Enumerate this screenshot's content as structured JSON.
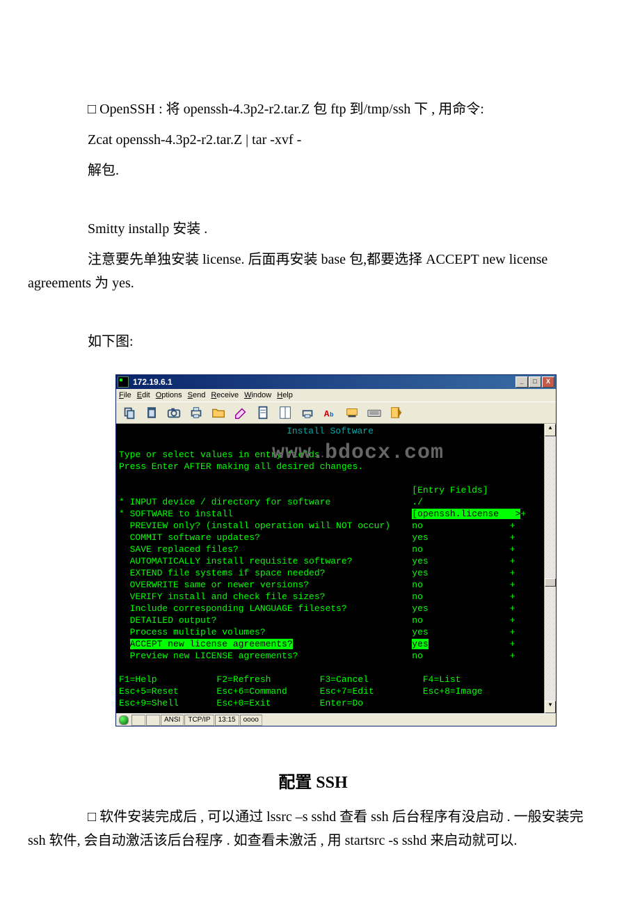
{
  "doc": {
    "p1": "□ OpenSSH : 将 openssh-4.3p2-r2.tar.Z 包 ftp 到/tmp/ssh 下 , 用命令:",
    "p2": "Zcat openssh-4.3p2-r2.tar.Z | tar -xvf -",
    "p3": "解包.",
    "p4": "Smitty installp 安装 .",
    "p5": "注意要先单独安装 license. 后面再安装 base 包,都要选择 ACCEPT new license agreements 为 yes.",
    "p6": "如下图:",
    "h2": "配置 SSH",
    "p7": "□ 软件安装完成后 , 可以通过 lssrc –s sshd 查看 ssh 后台程序有没启动 . 一般安装完 ssh 软件, 会自动激活该后台程序 . 如查看未激活 , 用 startsrc -s sshd 来启动就可以."
  },
  "term": {
    "title": "172.19.6.1",
    "menu": [
      "File",
      "Edit",
      "Options",
      "Send",
      "Receive",
      "Window",
      "Help"
    ],
    "screen": {
      "heading": "Install Software",
      "l1a": "Type or select values in entry fields",
      "l1b": ".",
      "l2": "Press Enter AFTER making all desired changes.",
      "wm": "www.bdocx.com",
      "entry": "[Entry Fields]",
      "rows": [
        {
          "star": "*",
          "label": "INPUT device / directory for software",
          "val": "./",
          "plus": ""
        },
        {
          "star": "*",
          "label": "SOFTWARE to install",
          "val": "[openssh.license   >",
          "plus": "+",
          "hival": true
        },
        {
          "star": " ",
          "label": "PREVIEW only? (install operation will NOT occur)",
          "val": "no",
          "plus": "+"
        },
        {
          "star": " ",
          "label": "COMMIT software updates?",
          "val": "yes",
          "plus": "+"
        },
        {
          "star": " ",
          "label": "SAVE replaced files?",
          "val": "no",
          "plus": "+"
        },
        {
          "star": " ",
          "label": "AUTOMATICALLY install requisite software?",
          "val": "yes",
          "plus": "+"
        },
        {
          "star": " ",
          "label": "EXTEND file systems if space needed?",
          "val": "yes",
          "plus": "+"
        },
        {
          "star": " ",
          "label": "OVERWRITE same or newer versions?",
          "val": "no",
          "plus": "+"
        },
        {
          "star": " ",
          "label": "VERIFY install and check file sizes?",
          "val": "no",
          "plus": "+"
        },
        {
          "star": " ",
          "label": "Include corresponding LANGUAGE filesets?",
          "val": "yes",
          "plus": "+"
        },
        {
          "star": " ",
          "label": "DETAILED output?",
          "val": "no",
          "plus": "+"
        },
        {
          "star": " ",
          "label": "Process multiple volumes?",
          "val": "yes",
          "plus": "+"
        },
        {
          "star": " ",
          "label": "ACCEPT new license agreements?",
          "val": "yes",
          "plus": "+",
          "hilabel": true,
          "hival": true
        },
        {
          "star": " ",
          "label": "Preview new LICENSE agreements?",
          "val": "no",
          "plus": "+"
        }
      ],
      "fkeys": [
        "F1=Help           F2=Refresh         F3=Cancel          F4=List",
        "Esc+5=Reset       Esc+6=Command      Esc+7=Edit         Esc+8=Image",
        "Esc+9=Shell       Esc+0=Exit         Enter=Do"
      ]
    },
    "status": {
      "ansi": "ANSI",
      "proto": "TCP/IP",
      "time": "13:15",
      "extra": "oooo"
    },
    "winbtns": {
      "min": "_",
      "max": "□",
      "close": "X"
    }
  }
}
